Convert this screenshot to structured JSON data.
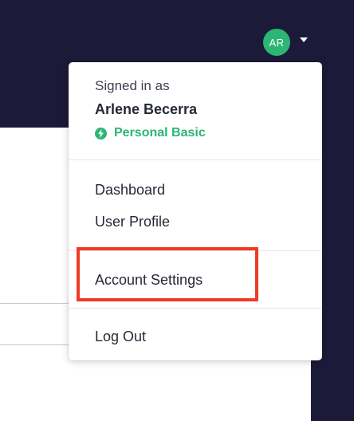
{
  "header": {
    "avatar_initials": "AR"
  },
  "menu": {
    "signed_in_label": "Signed in as",
    "user_name": "Arlene Becerra",
    "plan": "Personal Basic",
    "items": [
      {
        "label": "Dashboard"
      },
      {
        "label": "User Profile"
      },
      {
        "label": "Account Settings"
      },
      {
        "label": "Log Out"
      }
    ]
  },
  "colors": {
    "header_bg": "#1b1a38",
    "avatar_bg": "#2bb673",
    "plan_green": "#2bb673",
    "highlight_red": "#ee3b24"
  }
}
